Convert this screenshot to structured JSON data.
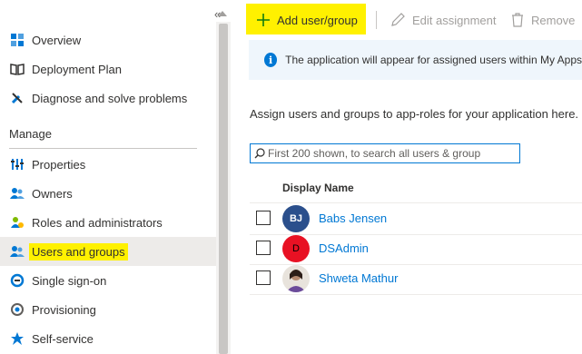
{
  "sidebar": {
    "collapse_glyph": "«",
    "items_top": [
      {
        "label": "Overview",
        "icon": "overview-grid-icon"
      },
      {
        "label": "Deployment Plan",
        "icon": "book-icon"
      },
      {
        "label": "Diagnose and solve problems",
        "icon": "wrench-icon"
      }
    ],
    "section_label": "Manage",
    "items_manage": [
      {
        "label": "Properties",
        "icon": "properties-icon"
      },
      {
        "label": "Owners",
        "icon": "owners-icon"
      },
      {
        "label": "Roles and administrators",
        "icon": "roles-icon"
      },
      {
        "label": "Users and groups",
        "icon": "users-groups-icon",
        "active": true
      },
      {
        "label": "Single sign-on",
        "icon": "sso-icon"
      },
      {
        "label": "Provisioning",
        "icon": "provisioning-icon"
      },
      {
        "label": "Self-service",
        "icon": "self-service-icon"
      }
    ]
  },
  "toolbar": {
    "add_label": "Add user/group",
    "edit_label": "Edit assignment",
    "remove_label": "Remove"
  },
  "info_banner": {
    "text": "The application will appear for assigned users within My Apps"
  },
  "main": {
    "description": "Assign users and groups to app-roles for your application here.",
    "search_placeholder": "First 200 shown, to search all users & group",
    "column_header": "Display Name",
    "users": [
      {
        "name": "Babs Jensen",
        "initials": "BJ",
        "avatar_color": "#2b4f8c"
      },
      {
        "name": "DSAdmin",
        "initials": "D",
        "avatar_color": "#e81123"
      },
      {
        "name": "Shweta Mathur",
        "initials": "",
        "avatar_color": "#a67c63"
      }
    ]
  },
  "colors": {
    "accent": "#0078d4",
    "highlight": "#fff100"
  }
}
